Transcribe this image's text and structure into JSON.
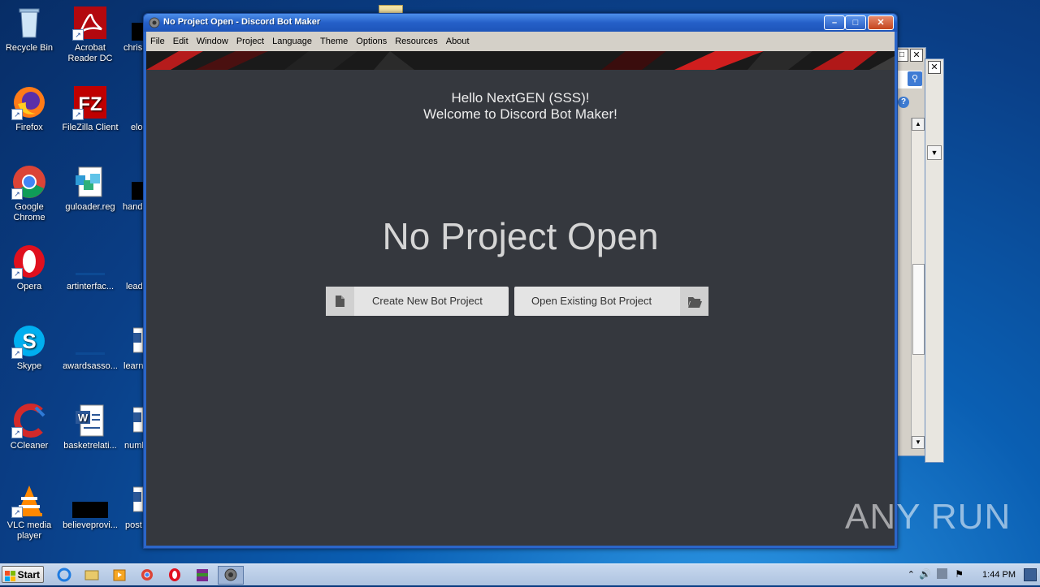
{
  "desktop": {
    "icons": [
      {
        "label": "Recycle Bin"
      },
      {
        "label": "Acrobat Reader DC"
      },
      {
        "label": "chris"
      },
      {
        "label": "Firefox"
      },
      {
        "label": "FileZilla Client"
      },
      {
        "label": "elo"
      },
      {
        "label": "Google Chrome"
      },
      {
        "label": "guloader.reg"
      },
      {
        "label": "hand"
      },
      {
        "label": "Opera"
      },
      {
        "label": "artinterfac..."
      },
      {
        "label": "lead"
      },
      {
        "label": "Skype"
      },
      {
        "label": "awardsasso..."
      },
      {
        "label": "learn"
      },
      {
        "label": "CCleaner"
      },
      {
        "label": "basketrelati..."
      },
      {
        "label": "numb"
      },
      {
        "label": "VLC media player"
      },
      {
        "label": "believeprovi..."
      },
      {
        "label": "post"
      }
    ]
  },
  "window": {
    "title": "No Project Open - Discord Bot Maker",
    "menu": [
      "File",
      "Edit",
      "Window",
      "Project",
      "Language",
      "Theme",
      "Options",
      "Resources",
      "About"
    ],
    "greeting_line1": "Hello NextGEN (SSS)!",
    "greeting_line2": "Welcome to Discord Bot Maker!",
    "heading": "No Project Open",
    "create_button": "Create New Bot Project",
    "open_button": "Open Existing Bot Project"
  },
  "taskbar": {
    "start_label": "Start",
    "clock": "1:44 PM"
  },
  "watermark": "ANY RUN",
  "colors": {
    "content_bg": "#35383e",
    "button_bg": "#e4e4e4",
    "titlebar": "#2560c8"
  }
}
